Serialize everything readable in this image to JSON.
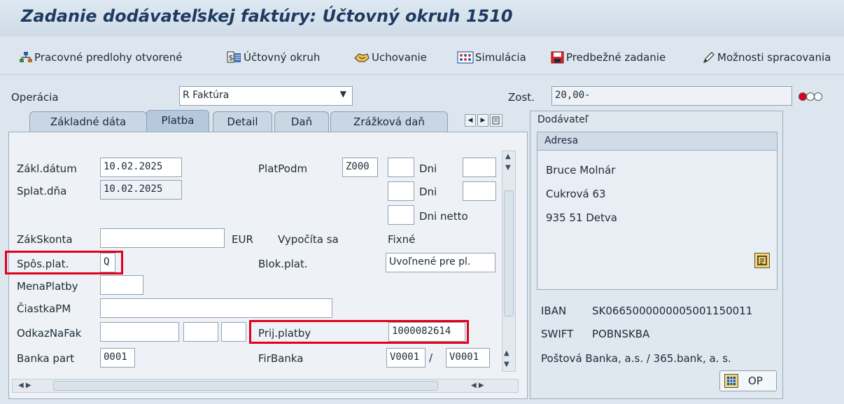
{
  "window": {
    "title": "Zadanie dodávateľskej faktúry: Účtovný okruh 1510"
  },
  "toolbar": {
    "items": [
      {
        "label": "Pracovné predlohy otvorené",
        "icon": "worklist-tree-icon"
      },
      {
        "label": "Účtovný okruh",
        "icon": "company-code-icon"
      },
      {
        "label": "Uchovanie",
        "icon": "hold-icon"
      },
      {
        "label": "Simulácia",
        "icon": "simulate-icon"
      },
      {
        "label": "Predbežné zadanie",
        "icon": "park-save-icon"
      },
      {
        "label": "Možnosti spracovania",
        "icon": "pencil-icon"
      }
    ]
  },
  "header": {
    "operation_label": "Operácia",
    "operation_value": "R Faktúra",
    "balance_label": "Zost.",
    "balance_value": "20,00-",
    "status_icon": "traffic-light-red-icon",
    "status_color": "#e0001b"
  },
  "tabs": [
    {
      "label": "Základné dáta",
      "active": false
    },
    {
      "label": "Platba",
      "active": true
    },
    {
      "label": "Detail",
      "active": false
    },
    {
      "label": "Daň",
      "active": false
    },
    {
      "label": "Zrážková daň",
      "active": false
    }
  ],
  "payment": {
    "baseline_date_label": "Zákl.dátum",
    "baseline_date_value": "10.02.2025",
    "due_date_label": "Splat.dňa",
    "due_date_value": "10.02.2025",
    "payment_terms_label": "PlatPodm",
    "payment_terms_value": "Z000",
    "days_label_1": "Dni",
    "days_label_2": "Dni",
    "days_net_label": "Dni netto",
    "discount_base_label": "ZákSkonta",
    "discount_currency": "EUR",
    "calculated_label": "Vypočíta sa",
    "fixed_label": "Fixné",
    "payment_method_label": "Spôs.plat.",
    "payment_method_value": "Q",
    "payment_block_label": "Blok.plat.",
    "payment_block_value": "Uvoľnené pre pl.",
    "payment_currency_label": "MenaPlatby",
    "amount_pc_label": "ČiastkaPM",
    "invoice_ref_label": "OdkazNaFak",
    "payment_ref_label": "Prij.platby",
    "payment_ref_value": "1000082614",
    "partner_bank_label": "Banka part",
    "partner_bank_value": "0001",
    "house_bank_label": "FirBanka",
    "house_bank_value_1": "V0001",
    "house_bank_separator": "/",
    "house_bank_value_2": "V0001"
  },
  "vendor": {
    "panel_title": "Dodávateľ",
    "address_title": "Adresa",
    "name": "Bruce Molnár",
    "street": "Cukrová 63",
    "city": "935 51 Detva",
    "iban_label": "IBAN",
    "iban_value": "SK0665000000005001150011",
    "swift_label": "SWIFT",
    "swift_value": "POBNSKBA",
    "bank_name": "Poštová Banka, a.s. / 365.bank, a. s.",
    "op_button_label": "OP"
  }
}
